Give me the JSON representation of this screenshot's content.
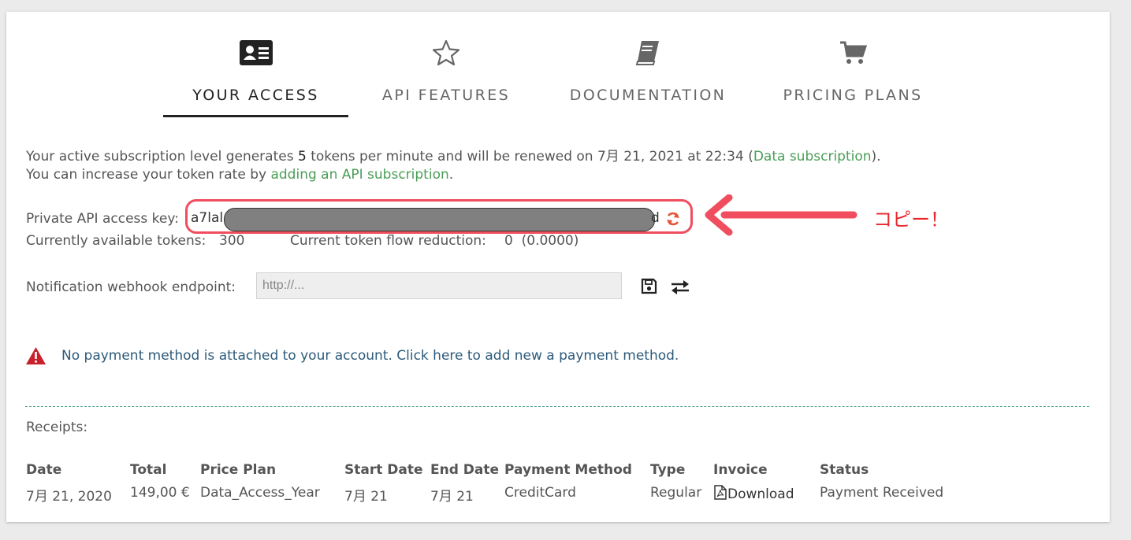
{
  "tabs": [
    {
      "label": "YOUR ACCESS",
      "icon": "id-card-icon",
      "active": true
    },
    {
      "label": "API FEATURES",
      "icon": "star-icon",
      "active": false
    },
    {
      "label": "DOCUMENTATION",
      "icon": "book-icon",
      "active": false
    },
    {
      "label": "PRICING PLANS",
      "icon": "shopping-cart-icon",
      "active": false
    }
  ],
  "subscription": {
    "line1_prefix": "Your active subscription level generates",
    "tokens_per_minute": "5",
    "line1_middle": "tokens per minute and will be renewed on 7月 21, 2021 at 22:34 (",
    "plan_link": "Data subscription",
    "line1_suffix": ").",
    "line2_prefix": "You can increase your token rate by",
    "line2_link": "adding an API subscription",
    "line2_suffix": "."
  },
  "api_key": {
    "label": "Private API access key:",
    "value_start": "a7lal",
    "value_end": "d",
    "refresh_icon": "refresh-icon"
  },
  "tokens": {
    "available_label": "Currently available tokens:",
    "available_value": "300",
    "reduction_label": "Current token flow reduction:",
    "reduction_value": "0  (0.0000)"
  },
  "annotation": {
    "text": "コピー！",
    "color": "#e8262d"
  },
  "webhook": {
    "label": "Notification webhook endpoint:",
    "placeholder": "http://...",
    "save_icon": "floppy-disk-icon",
    "exchange_icon": "exchange-icon"
  },
  "warning": {
    "icon": "warning-icon",
    "text": "No payment method is attached to your account. Click here to add new a payment method."
  },
  "receipts": {
    "label": "Receipts:",
    "columns": [
      "Date",
      "Total",
      "Price Plan",
      "Start Date",
      "End Date",
      "Payment Method",
      "Type",
      "Invoice",
      "Status"
    ],
    "rows": [
      [
        "7月 21, 2020",
        "149,00 €",
        "Data_Access_Year",
        "7月 21",
        "7月 21",
        "CreditCard",
        "Regular",
        "Download",
        "Payment Received"
      ]
    ]
  },
  "colors": {
    "link_green": "#4a9e57",
    "highlight_red": "#f04e5e",
    "warning_red": "#c9202b",
    "warning_text": "#2c5a7a"
  }
}
